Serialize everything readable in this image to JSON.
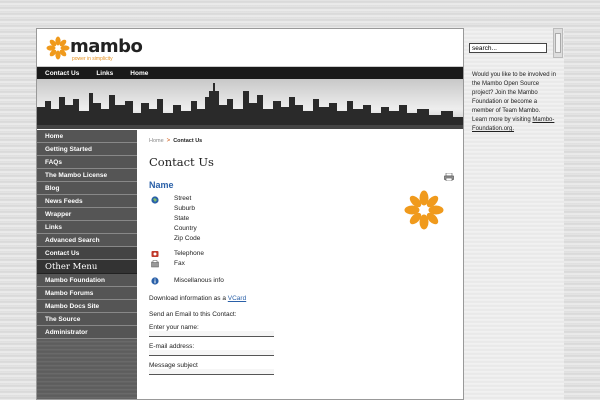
{
  "logo": {
    "name": "mambo",
    "tagline": "power in simplicity"
  },
  "topnav": [
    "Contact Us",
    "Links",
    "Home"
  ],
  "leftnav": {
    "main_items": [
      "Home",
      "Getting Started",
      "FAQs",
      "The Mambo License",
      "Blog",
      "News Feeds",
      "Wrapper",
      "Links",
      "Advanced Search",
      "Contact Us"
    ],
    "other_heading": "Other Menu",
    "other_items": [
      "Mambo Foundation",
      "Mambo Forums",
      "Mambo Docs Site",
      "The Source",
      "Administrator"
    ]
  },
  "breadcrumb": {
    "home": "Home",
    "separator": ">",
    "current": "Contact Us"
  },
  "page_title": "Contact Us",
  "contact": {
    "name": "Name",
    "address": [
      "Street",
      "Suburb",
      "State",
      "Country",
      "Zip Code"
    ],
    "telephone": "Telephone",
    "fax": "Fax",
    "misc": "Miscellanous info",
    "download_text": "Download information as a",
    "vcard": "VCard",
    "email_intro": "Send an Email to this Contact:",
    "form": {
      "name_label": "Enter your name:",
      "email_label": "E-mail address:",
      "subject_label": "Message subject"
    }
  },
  "sidebar": {
    "search_value": "search...",
    "invite_text": "Would you like to be involved in the Mambo Open Source project? Join the Mambo Foundation or become a member of Team Mambo. Learn more by visiting",
    "invite_link": "Mambo-Foundation.org."
  },
  "colors": {
    "accent": "#e6901c",
    "link": "#2a60a8",
    "nav_bg": "#1a1a1a"
  },
  "icons": [
    "print-icon",
    "address-icon",
    "phone-icon",
    "fax-icon",
    "info-icon"
  ]
}
